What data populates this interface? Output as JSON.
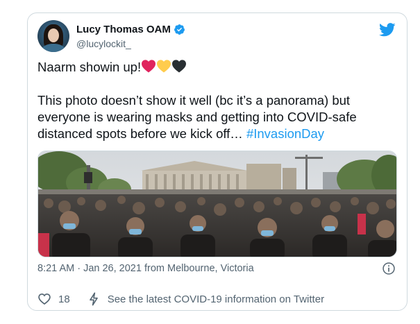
{
  "tweet": {
    "author_name": "Lucy Thomas OAM",
    "author_handle": "@lucylockit_",
    "line1": "Naarm showin up!",
    "heart_colors": [
      "#e0245e",
      "#ffcc4d",
      "#292f33"
    ],
    "body_text": "This photo doesn’t show it well (bc it’s a panorama) but everyone is wearing masks and getting into COVID-safe distanced spots before we kick off… ",
    "hashtag": "#InvasionDay",
    "timestamp": "8:21 AM · Jan 26, 2021 from Melbourne, Victoria",
    "like_count": "18",
    "covid_link": "See the latest COVID-19 information on Twitter"
  },
  "icons": {
    "verified": "verified-badge-icon",
    "bird": "twitter-bird-icon",
    "info": "info-icon",
    "like": "heart-outline-icon",
    "covid": "lightning-bolt-icon"
  },
  "colors": {
    "link": "#1d9bf0",
    "text": "#0f1419",
    "secondary": "#536471",
    "border": "#cfd9de"
  }
}
